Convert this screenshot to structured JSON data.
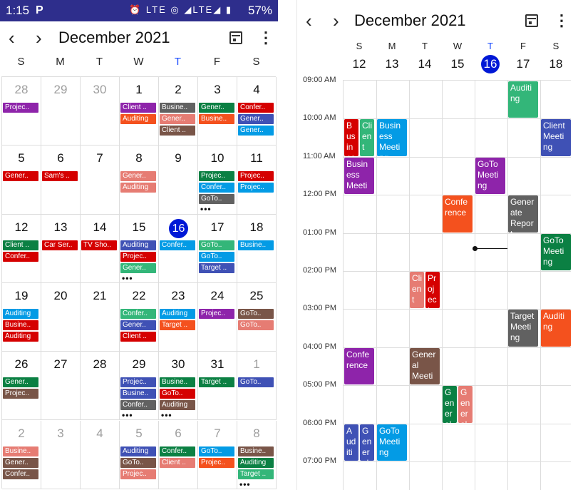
{
  "status": {
    "time": "1:15",
    "app_badge": "P",
    "signal_icons": "⏰ LTE ◎ ◢LTE◢ ▮",
    "battery": "57%"
  },
  "month_view": {
    "title": "December 2021",
    "weekdays": [
      "S",
      "M",
      "T",
      "W",
      "T",
      "F",
      "S"
    ],
    "today_weekday_index": 4,
    "weeks": [
      [
        {
          "day": "28",
          "dim": true,
          "events": [
            {
              "t": "Projec..",
              "c": "purple"
            }
          ]
        },
        {
          "day": "29",
          "dim": true,
          "events": []
        },
        {
          "day": "30",
          "dim": true,
          "events": []
        },
        {
          "day": "1",
          "events": [
            {
              "t": "Client ..",
              "c": "purple"
            },
            {
              "t": "Auditing",
              "c": "orange"
            }
          ]
        },
        {
          "day": "2",
          "events": [
            {
              "t": "Busine..",
              "c": "gray"
            },
            {
              "t": "Gener..",
              "c": "pink"
            },
            {
              "t": "Client ..",
              "c": "brown"
            }
          ]
        },
        {
          "day": "3",
          "events": [
            {
              "t": "Gener..",
              "c": "green"
            },
            {
              "t": "Busine..",
              "c": "orange"
            }
          ]
        },
        {
          "day": "4",
          "events": [
            {
              "t": "Confer..",
              "c": "red"
            },
            {
              "t": "Gener..",
              "c": "indigo"
            },
            {
              "t": "Gener..",
              "c": "blue"
            }
          ]
        }
      ],
      [
        {
          "day": "5",
          "events": [
            {
              "t": "Gener..",
              "c": "red"
            }
          ]
        },
        {
          "day": "6",
          "events": [
            {
              "t": "Sam's ..",
              "c": "red"
            }
          ]
        },
        {
          "day": "7",
          "events": []
        },
        {
          "day": "8",
          "events": [
            {
              "t": "Gener..",
              "c": "pink"
            },
            {
              "t": "Auditing",
              "c": "pink"
            }
          ]
        },
        {
          "day": "9",
          "events": []
        },
        {
          "day": "10",
          "events": [
            {
              "t": "Projec..",
              "c": "green"
            },
            {
              "t": "Confer..",
              "c": "blue"
            },
            {
              "t": "GoTo..",
              "c": "gray"
            }
          ],
          "more": true
        },
        {
          "day": "11",
          "events": [
            {
              "t": "Projec..",
              "c": "red"
            },
            {
              "t": "Projec..",
              "c": "blue"
            }
          ]
        }
      ],
      [
        {
          "day": "12",
          "events": [
            {
              "t": "Client ..",
              "c": "green"
            },
            {
              "t": "Confer..",
              "c": "red"
            }
          ]
        },
        {
          "day": "13",
          "events": [
            {
              "t": "Car Ser..",
              "c": "red"
            }
          ]
        },
        {
          "day": "14",
          "events": [
            {
              "t": "TV Sho..",
              "c": "red"
            }
          ]
        },
        {
          "day": "15",
          "events": [
            {
              "t": "Auditing",
              "c": "indigo"
            },
            {
              "t": "Projec..",
              "c": "red"
            },
            {
              "t": "Gener..",
              "c": "teal"
            }
          ],
          "more": true
        },
        {
          "day": "16",
          "selected": true,
          "events": [
            {
              "t": "Confer..",
              "c": "blue"
            }
          ]
        },
        {
          "day": "17",
          "events": [
            {
              "t": "GoTo..",
              "c": "teal"
            },
            {
              "t": "GoTo..",
              "c": "blue"
            },
            {
              "t": "Target ..",
              "c": "indigo"
            }
          ]
        },
        {
          "day": "18",
          "events": [
            {
              "t": "Busine..",
              "c": "blue"
            }
          ]
        }
      ],
      [
        {
          "day": "19",
          "events": [
            {
              "t": "Auditing",
              "c": "blue"
            },
            {
              "t": "Busine..",
              "c": "red"
            },
            {
              "t": "Auditing",
              "c": "red"
            }
          ]
        },
        {
          "day": "20",
          "events": []
        },
        {
          "day": "21",
          "events": []
        },
        {
          "day": "22",
          "events": [
            {
              "t": "Confer..",
              "c": "teal"
            },
            {
              "t": "Gener..",
              "c": "indigo"
            },
            {
              "t": "Client ..",
              "c": "red"
            }
          ]
        },
        {
          "day": "23",
          "events": [
            {
              "t": "Auditing",
              "c": "blue"
            },
            {
              "t": "Target ..",
              "c": "orange"
            }
          ]
        },
        {
          "day": "24",
          "events": [
            {
              "t": "Projec..",
              "c": "purple"
            }
          ]
        },
        {
          "day": "25",
          "events": [
            {
              "t": "GoTo..",
              "c": "brown"
            },
            {
              "t": "GoTo..",
              "c": "pink"
            }
          ]
        }
      ],
      [
        {
          "day": "26",
          "events": [
            {
              "t": "Gener..",
              "c": "green"
            },
            {
              "t": "Projec..",
              "c": "brown"
            }
          ]
        },
        {
          "day": "27",
          "events": []
        },
        {
          "day": "28",
          "events": []
        },
        {
          "day": "29",
          "events": [
            {
              "t": "Projec..",
              "c": "indigo"
            },
            {
              "t": "Busine..",
              "c": "indigo"
            },
            {
              "t": "Confer..",
              "c": "gray"
            }
          ],
          "more": true
        },
        {
          "day": "30",
          "events": [
            {
              "t": "Busine..",
              "c": "green"
            },
            {
              "t": "GoTo..",
              "c": "red"
            },
            {
              "t": "Auditing",
              "c": "brown"
            }
          ],
          "more": true
        },
        {
          "day": "31",
          "events": [
            {
              "t": "Target ..",
              "c": "green"
            }
          ]
        },
        {
          "day": "1",
          "dim": true,
          "events": [
            {
              "t": "GoTo..",
              "c": "indigo"
            }
          ]
        }
      ],
      [
        {
          "day": "2",
          "dim": true,
          "events": [
            {
              "t": "Busine..",
              "c": "pink"
            },
            {
              "t": "Gener..",
              "c": "brown"
            },
            {
              "t": "Confer..",
              "c": "brown"
            }
          ]
        },
        {
          "day": "3",
          "dim": true,
          "events": []
        },
        {
          "day": "4",
          "dim": true,
          "events": []
        },
        {
          "day": "5",
          "dim": true,
          "events": [
            {
              "t": "Auditing",
              "c": "indigo"
            },
            {
              "t": "GoTo..",
              "c": "brown"
            },
            {
              "t": "Projec..",
              "c": "pink"
            }
          ]
        },
        {
          "day": "6",
          "dim": true,
          "events": [
            {
              "t": "Confer..",
              "c": "green"
            },
            {
              "t": "Client ..",
              "c": "pink"
            }
          ]
        },
        {
          "day": "7",
          "dim": true,
          "events": [
            {
              "t": "GoTo..",
              "c": "blue"
            },
            {
              "t": "Projec..",
              "c": "orange"
            }
          ]
        },
        {
          "day": "8",
          "dim": true,
          "events": [
            {
              "t": "Busine..",
              "c": "brown"
            },
            {
              "t": "Auditing",
              "c": "green"
            },
            {
              "t": "Target ..",
              "c": "teal"
            }
          ],
          "more": true
        }
      ]
    ]
  },
  "week_view": {
    "title": "December 2021",
    "days": [
      {
        "l": "S",
        "n": "12"
      },
      {
        "l": "M",
        "n": "13"
      },
      {
        "l": "T",
        "n": "14"
      },
      {
        "l": "W",
        "n": "15"
      },
      {
        "l": "T",
        "n": "16",
        "today": true
      },
      {
        "l": "F",
        "n": "17"
      },
      {
        "l": "S",
        "n": "18"
      }
    ],
    "times": [
      "09:00 AM",
      "10:00 AM",
      "11:00 AM",
      "12:00 PM",
      "01:00 PM",
      "02:00 PM",
      "03:00 PM",
      "04:00 PM",
      "05:00 PM",
      "06:00 PM",
      "07:00 PM"
    ],
    "now_hour": 13.4,
    "events": [
      {
        "day": 5,
        "start": 9,
        "end": 10,
        "text": "Auditing",
        "c": "teal"
      },
      {
        "day": 0,
        "start": 10,
        "end": 11,
        "text": "Business Meeting",
        "c": "red",
        "col": 0,
        "cols": 2
      },
      {
        "day": 0,
        "start": 10,
        "end": 11,
        "text": "Client",
        "c": "teal",
        "col": 1,
        "cols": 2
      },
      {
        "day": 1,
        "start": 10,
        "end": 11,
        "text": "Business Meeting",
        "c": "blue"
      },
      {
        "day": 6,
        "start": 10,
        "end": 11,
        "text": "Client Meeting",
        "c": "indigo"
      },
      {
        "day": 0,
        "start": 11,
        "end": 12,
        "text": "Business Meeting",
        "c": "purple"
      },
      {
        "day": 4,
        "start": 11,
        "end": 12,
        "text": "GoTo Meeting",
        "c": "purple"
      },
      {
        "day": 3,
        "start": 12,
        "end": 13,
        "text": "Conference",
        "c": "orange"
      },
      {
        "day": 5,
        "start": 12,
        "end": 13,
        "text": "Generate Report",
        "c": "gray"
      },
      {
        "day": 6,
        "start": 13,
        "end": 14,
        "text": "GoTo Meeting",
        "c": "green"
      },
      {
        "day": 2,
        "start": 14,
        "end": 15,
        "text": "Client",
        "c": "pink",
        "col": 0,
        "cols": 2
      },
      {
        "day": 2,
        "start": 14,
        "end": 15,
        "text": "Project",
        "c": "red",
        "col": 1,
        "cols": 2
      },
      {
        "day": 5,
        "start": 15,
        "end": 16,
        "text": "Target Meeting",
        "c": "gray"
      },
      {
        "day": 6,
        "start": 15,
        "end": 16,
        "text": "Auditing",
        "c": "orange"
      },
      {
        "day": 0,
        "start": 16,
        "end": 17,
        "text": "Conference",
        "c": "purple"
      },
      {
        "day": 2,
        "start": 16,
        "end": 17,
        "text": "General Meeting",
        "c": "brown"
      },
      {
        "day": 3,
        "start": 17,
        "end": 18,
        "text": "General",
        "c": "green",
        "col": 0,
        "cols": 2
      },
      {
        "day": 3,
        "start": 17,
        "end": 18,
        "text": "General",
        "c": "pink",
        "col": 1,
        "cols": 2
      },
      {
        "day": 0,
        "start": 18,
        "end": 19,
        "text": "Auditing",
        "c": "indigo",
        "col": 0,
        "cols": 2
      },
      {
        "day": 0,
        "start": 18,
        "end": 19,
        "text": "General",
        "c": "indigo",
        "col": 1,
        "cols": 2
      },
      {
        "day": 1,
        "start": 18,
        "end": 19,
        "text": "GoTo Meeting",
        "c": "blue"
      }
    ]
  },
  "colors": {
    "purple": "#8e24aa",
    "orange": "#f4511e",
    "gray": "#616161",
    "pink": "#e67c73",
    "brown": "#795548",
    "green": "#0b8043",
    "red": "#d50000",
    "indigo": "#3f51b5",
    "blue": "#039be5",
    "teal": "#33b679",
    "today_blue": "#0018d6"
  }
}
